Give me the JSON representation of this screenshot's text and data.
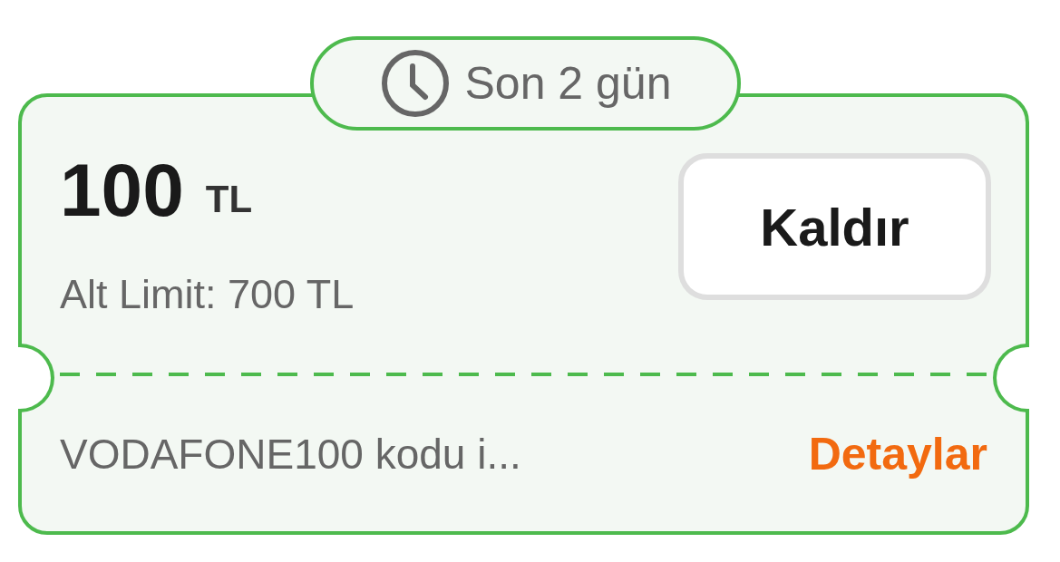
{
  "badge": {
    "text": "Son 2 gün"
  },
  "amount": {
    "value": "100",
    "unit": "TL"
  },
  "min_limit": "Alt Limit: 700 TL",
  "button": "Kaldır",
  "description": "VODAFONE100 kodu i...",
  "link": "Detaylar"
}
